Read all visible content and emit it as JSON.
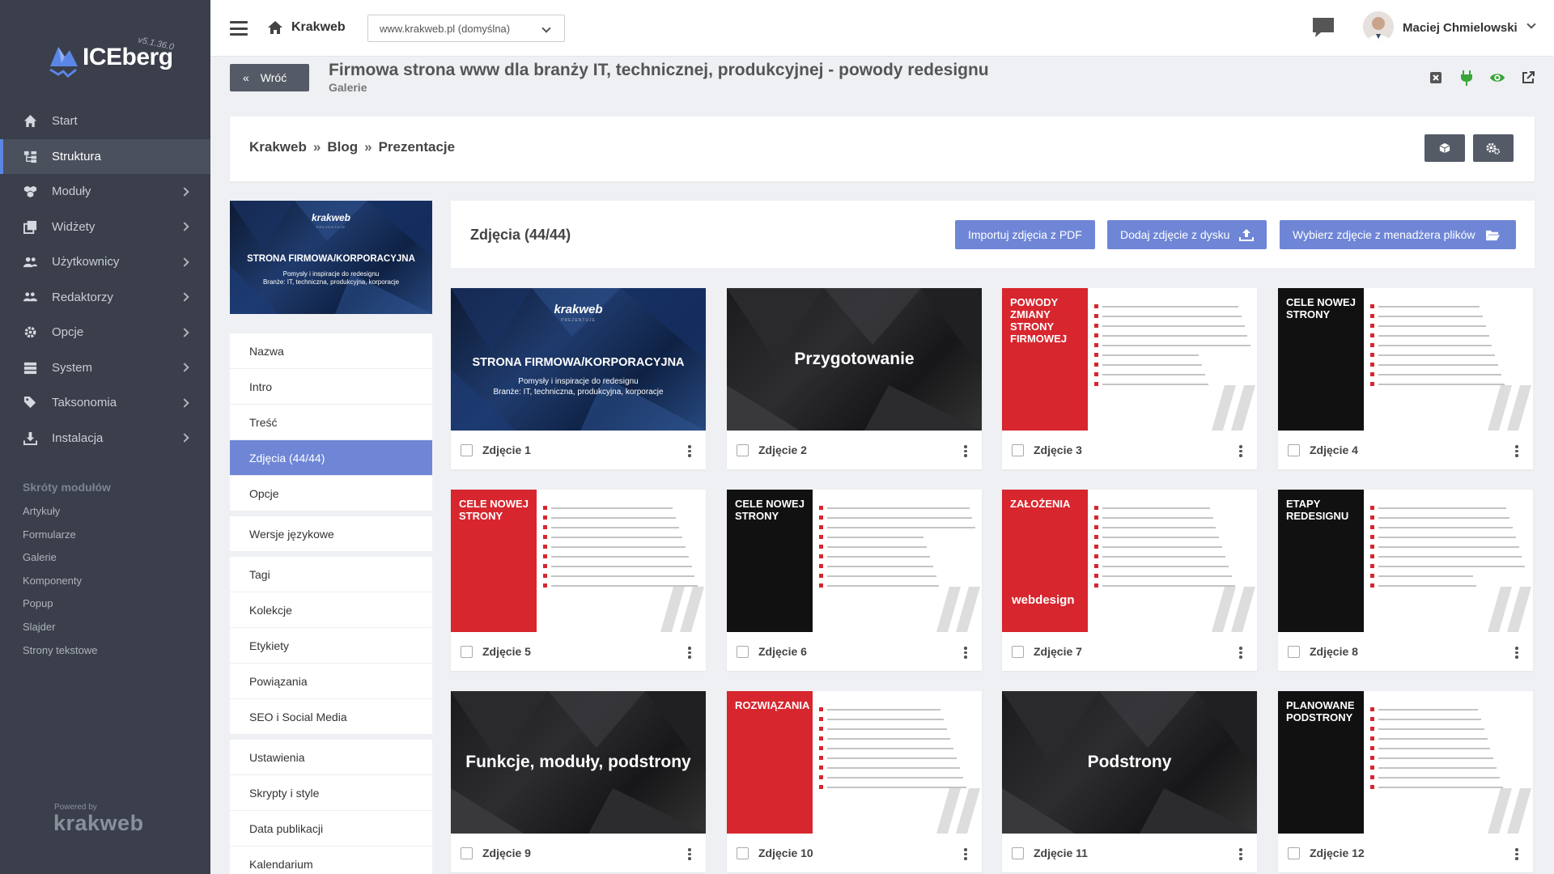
{
  "app": {
    "name": "ICEberg",
    "version": "v5.1.36.0"
  },
  "sidebar": {
    "items": [
      {
        "label": "Start",
        "icon": "home-icon",
        "active": false,
        "chevron": false
      },
      {
        "label": "Struktura",
        "icon": "sitemap-icon",
        "active": true,
        "chevron": false
      },
      {
        "label": "Moduły",
        "icon": "cubes-icon",
        "active": false,
        "chevron": true
      },
      {
        "label": "Widżety",
        "icon": "clone-icon",
        "active": false,
        "chevron": true
      },
      {
        "label": "Użytkownicy",
        "icon": "users-icon",
        "active": false,
        "chevron": true
      },
      {
        "label": "Redaktorzy",
        "icon": "editors-icon",
        "active": false,
        "chevron": true
      },
      {
        "label": "Opcje",
        "icon": "gear-icon",
        "active": false,
        "chevron": true
      },
      {
        "label": "System",
        "icon": "server-icon",
        "active": false,
        "chevron": true
      },
      {
        "label": "Taksonomia",
        "icon": "tags-icon",
        "active": false,
        "chevron": true
      },
      {
        "label": "Instalacja",
        "icon": "download-icon",
        "active": false,
        "chevron": true
      }
    ],
    "shortcuts_title": "Skróty modułów",
    "shortcuts": [
      "Artykuły",
      "Formularze",
      "Galerie",
      "Komponenty",
      "Popup",
      "Slajder",
      "Strony tekstowe"
    ],
    "powered_by": "Powered by",
    "powered_logo": "krakweb"
  },
  "topbar": {
    "site_name": "Krakweb",
    "site_select": "www.krakweb.pl (domyślna)",
    "user_name": "Maciej Chmielowski"
  },
  "header": {
    "back_label": "Wróć",
    "title": "Firmowa strona www dla branży IT, technicznej, produkcyjnej - powody redesignu",
    "subtitle": "Galerie"
  },
  "breadcrumb": [
    "Krakweb",
    "Blog",
    "Prezentacje"
  ],
  "breadcrumb_sep": "»",
  "cover": {
    "brand": "krakweb",
    "brand_sub": "PREZENTUJE",
    "title": "STRONA FIRMOWA/KORPORACYJNA",
    "line1": "Pomysły i inspiracje do redesignu",
    "line2": "Branże: IT, techniczna, produkcyjna, korporacje"
  },
  "menu": [
    {
      "label": "Nazwa",
      "active": false,
      "gap": false
    },
    {
      "label": "Intro",
      "active": false,
      "gap": false
    },
    {
      "label": "Treść",
      "active": false,
      "gap": false
    },
    {
      "label": "Zdjęcia (44/44)",
      "active": true,
      "gap": false
    },
    {
      "label": "Opcje",
      "active": false,
      "gap": false
    },
    {
      "label": "Wersje językowe",
      "active": false,
      "gap": true
    },
    {
      "label": "Tagi",
      "active": false,
      "gap": true
    },
    {
      "label": "Kolekcje",
      "active": false,
      "gap": false
    },
    {
      "label": "Etykiety",
      "active": false,
      "gap": false
    },
    {
      "label": "Powiązania",
      "active": false,
      "gap": false
    },
    {
      "label": "SEO i Social Media",
      "active": false,
      "gap": false
    },
    {
      "label": "Ustawienia",
      "active": false,
      "gap": true
    },
    {
      "label": "Skrypty i style",
      "active": false,
      "gap": false
    },
    {
      "label": "Data publikacji",
      "active": false,
      "gap": false
    },
    {
      "label": "Kalendarium",
      "active": false,
      "gap": false
    }
  ],
  "photos": {
    "title": "Zdjęcia (44/44)",
    "btn_import_pdf": "Importuj zdjęcia z PDF",
    "btn_add_disk": "Dodaj zdjęcie z dysku",
    "btn_file_manager": "Wybierz zdjęcie z menadżera plików",
    "items": [
      {
        "label": "Zdjęcie 1",
        "kind": "cover",
        "heading": "STRONA FIRMOWA/KORPORACYJNA",
        "brand": "krakweb",
        "brand_sub": "PREZENTUJE",
        "line1": "Pomysły i inspiracje do redesignu",
        "line2": "Branże: IT, techniczna, produkcyjna, korporacje"
      },
      {
        "label": "Zdjęcie 2",
        "kind": "dark",
        "heading": "Przygotowanie"
      },
      {
        "label": "Zdjęcie 3",
        "kind": "split",
        "color": "#d7262e",
        "heading": "POWODY ZMIANY STRONY FIRMOWEJ"
      },
      {
        "label": "Zdjęcie 4",
        "kind": "split",
        "color": "#111111",
        "heading": "CELE NOWEJ STRONY"
      },
      {
        "label": "Zdjęcie 5",
        "kind": "split",
        "color": "#d7262e",
        "heading": "CELE NOWEJ STRONY"
      },
      {
        "label": "Zdjęcie 6",
        "kind": "split",
        "color": "#111111",
        "heading": "CELE NOWEJ STRONY"
      },
      {
        "label": "Zdjęcie 7",
        "kind": "split",
        "color": "#d7262e",
        "heading": "ZAŁOŻENIA",
        "sub": "webdesign"
      },
      {
        "label": "Zdjęcie 8",
        "kind": "split",
        "color": "#111111",
        "heading": "ETAPY REDESIGNU"
      },
      {
        "label": "Zdjęcie 9",
        "kind": "dark",
        "heading": "Funkcje, moduły, podstrony"
      },
      {
        "label": "Zdjęcie 10",
        "kind": "split",
        "color": "#d7262e",
        "heading": "ROZWIĄZANIA"
      },
      {
        "label": "Zdjęcie 11",
        "kind": "dark",
        "heading": "Podstrony"
      },
      {
        "label": "Zdjęcie 12",
        "kind": "split",
        "color": "#111111",
        "heading": "PLANOWANE PODSTRONY"
      }
    ]
  },
  "colors": {
    "accent": "#6f86d6",
    "sidebar": "#3a3f4b",
    "green": "#3aa53a",
    "red": "#d7262e"
  }
}
